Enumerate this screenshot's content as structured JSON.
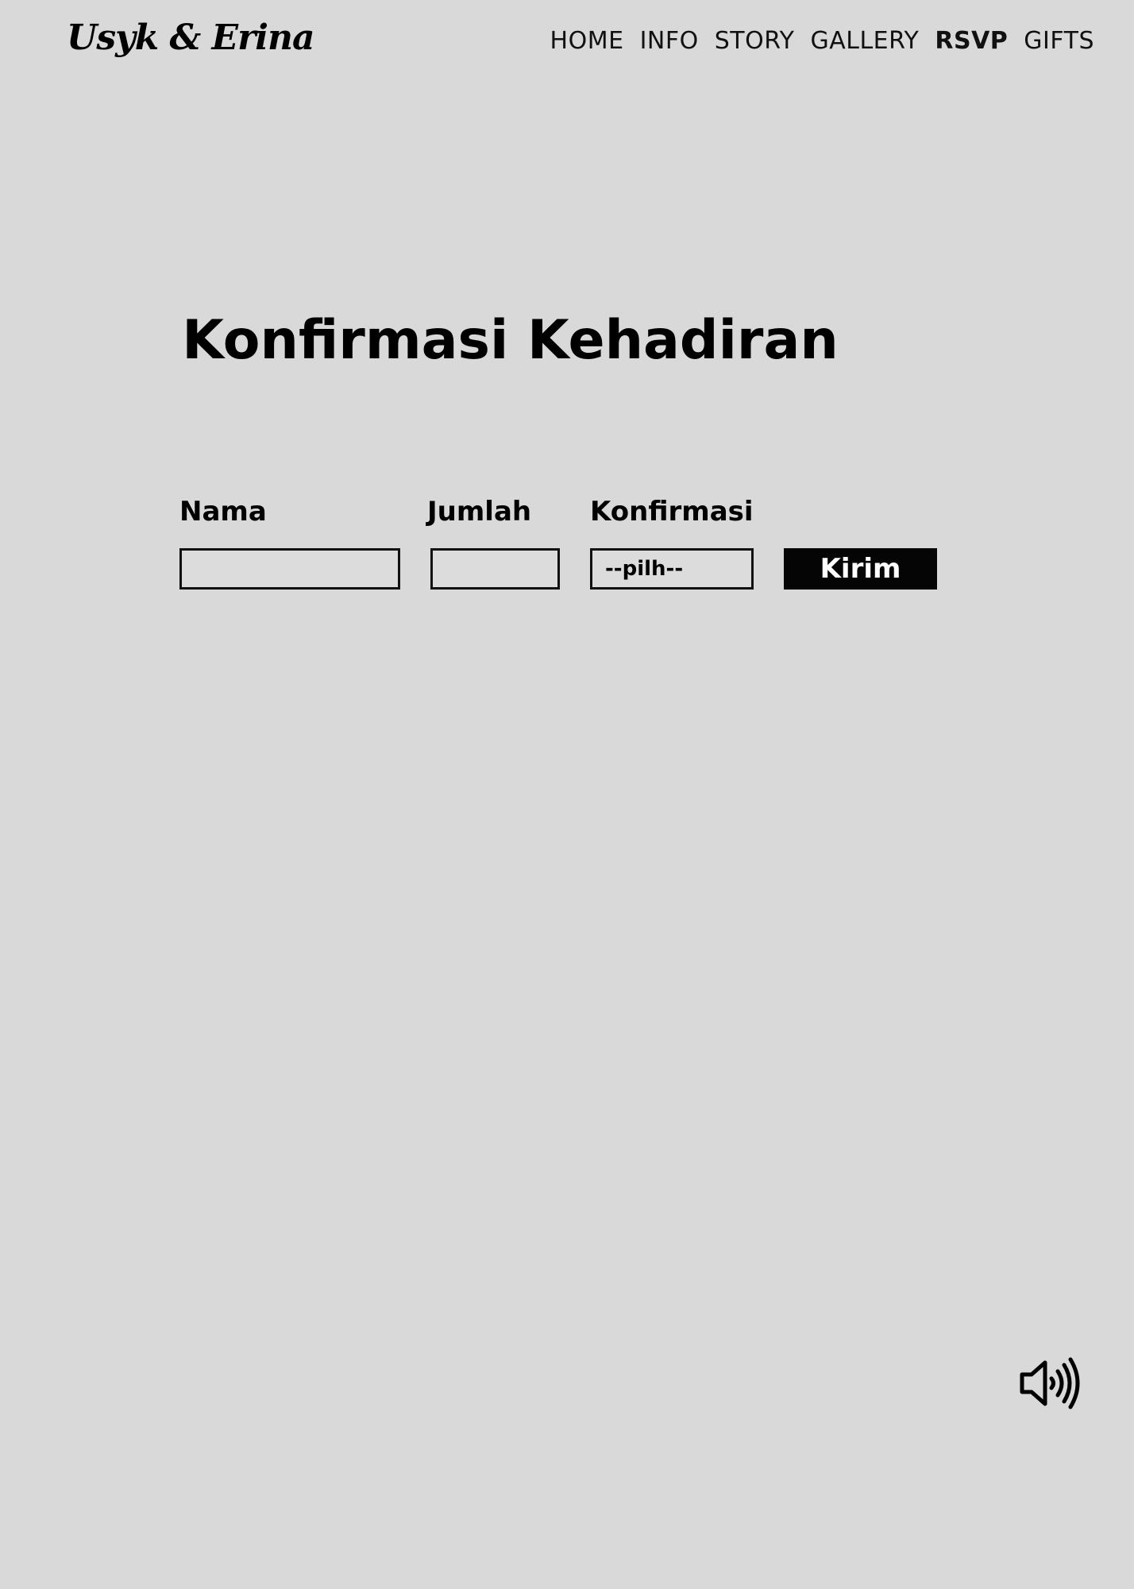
{
  "brand": {
    "logo_text": "Usyk & Erina"
  },
  "nav": {
    "items": [
      "HOME",
      "INFO",
      "STORY",
      "GALLERY",
      "RSVP",
      "GIFTS"
    ],
    "active": "RSVP"
  },
  "rsvp": {
    "title": "Konfirmasi Kehadiran",
    "name_label": "Nama",
    "name_value": "",
    "count_label": "Jumlah",
    "count_value": "",
    "confirm_label": "Konfirmasi",
    "confirm_selected": "--pilh--",
    "submit_label": "Kirim"
  },
  "audio": {
    "icon": "speaker-volume-icon"
  },
  "colors": {
    "background": "#d9d9d9",
    "text": "#000000",
    "button_bg": "#050505",
    "button_text": "#ffffff"
  }
}
